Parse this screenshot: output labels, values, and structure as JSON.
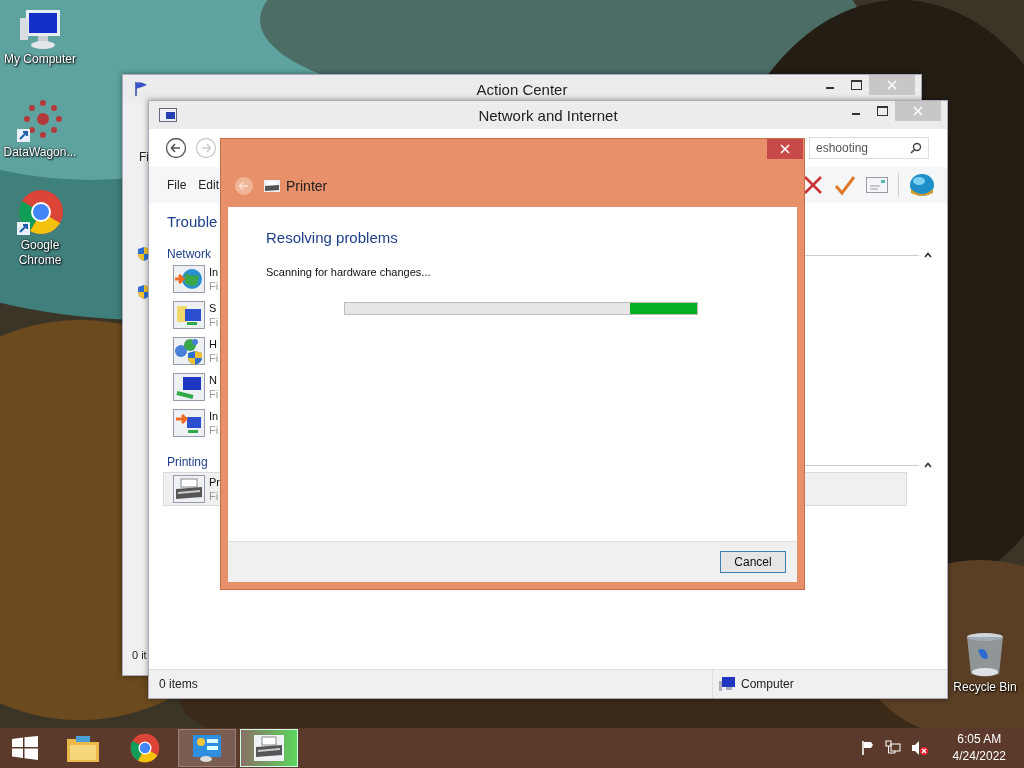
{
  "desktop_icons": [
    {
      "kind": "computer",
      "label": "My Computer"
    },
    {
      "kind": "datawagon",
      "label": "DataWagon..."
    },
    {
      "kind": "chrome",
      "label": "Google Chrome"
    },
    {
      "kind": "recycle",
      "label": "Recycle Bin"
    }
  ],
  "action_center": {
    "title": "Action Center",
    "menu_fragment": "Fi",
    "status": "0 it"
  },
  "network_window": {
    "title": "Network and Internet",
    "search": {
      "value": "eshooting"
    },
    "menu": [
      "File",
      "Edit"
    ],
    "heading": "Trouble",
    "sections": [
      {
        "title": "Network",
        "items": [
          {
            "kind": "internet",
            "title": "In",
            "subtitle": "Fi",
            "selected": false
          },
          {
            "kind": "shared",
            "title": "S",
            "subtitle": "Fi",
            "selected": false
          },
          {
            "kind": "homegroup",
            "title": "H",
            "subtitle": "Fi",
            "selected": false
          },
          {
            "kind": "adapter",
            "title": "N",
            "subtitle": "Fi",
            "selected": false
          },
          {
            "kind": "incoming",
            "title": "In",
            "subtitle": "Fi",
            "selected": false
          }
        ]
      },
      {
        "title": "Printing",
        "items": [
          {
            "kind": "printer",
            "title": "Pr",
            "subtitle": "Fi",
            "selected": true
          }
        ]
      }
    ],
    "status": {
      "items": "0 items",
      "location": "Computer"
    }
  },
  "dialog": {
    "title": "Printer",
    "heading": "Resolving problems",
    "message": "Scanning for hardware changes...",
    "progress": {
      "level": 0.19
    },
    "button": "Cancel"
  },
  "taskbar": {
    "apps": [
      {
        "kind": "explorer",
        "open": false,
        "flashing": false
      },
      {
        "kind": "chrome",
        "open": false,
        "flashing": false
      },
      {
        "kind": "control-panel",
        "open": true,
        "flashing": false
      },
      {
        "kind": "printer",
        "open": true,
        "flashing": true
      }
    ],
    "clock": {
      "time": "6:05 AM",
      "date": "4/24/2022"
    }
  }
}
